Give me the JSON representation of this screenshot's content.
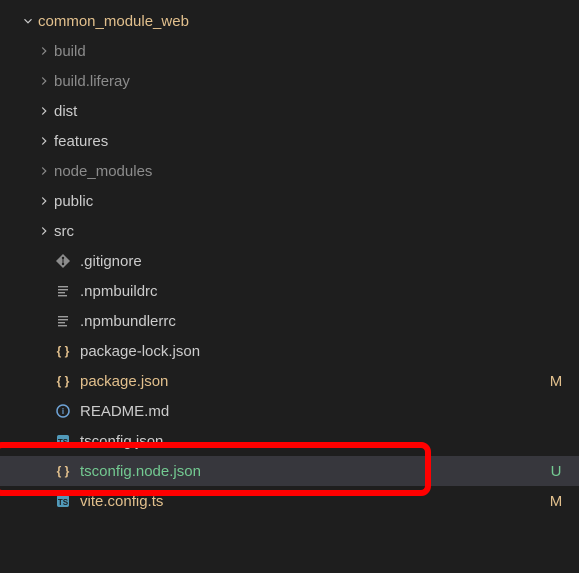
{
  "root": {
    "name": "common_module_web",
    "status_dot": true
  },
  "items": [
    {
      "name": "build",
      "kind": "folder",
      "dim": true
    },
    {
      "name": "build.liferay",
      "kind": "folder",
      "dim": true
    },
    {
      "name": "dist",
      "kind": "folder",
      "dim": false
    },
    {
      "name": "features",
      "kind": "folder",
      "dim": false
    },
    {
      "name": "node_modules",
      "kind": "folder",
      "dim": true
    },
    {
      "name": "public",
      "kind": "folder",
      "dim": false
    },
    {
      "name": "src",
      "kind": "folder",
      "dim": false
    },
    {
      "name": ".gitignore",
      "kind": "git",
      "dim": false
    },
    {
      "name": ".npmbuildrc",
      "kind": "lines",
      "dim": false
    },
    {
      "name": ".npmbundlerrc",
      "kind": "lines",
      "dim": false
    },
    {
      "name": "package-lock.json",
      "kind": "json",
      "dim": false
    },
    {
      "name": "package.json",
      "kind": "json",
      "dim": false,
      "status": "M",
      "statusCls": "c-mod",
      "labelCls": "c-mod"
    },
    {
      "name": "README.md",
      "kind": "md",
      "dim": false
    },
    {
      "name": "tsconfig.json",
      "kind": "ts",
      "dim": false
    },
    {
      "name": "tsconfig.node.json",
      "kind": "json",
      "dim": false,
      "status": "U",
      "statusCls": "c-new",
      "labelCls": "c-new",
      "selected": true,
      "highlighted": true
    },
    {
      "name": "vite.config.ts",
      "kind": "ts",
      "dim": false,
      "status": "M",
      "statusCls": "c-mod",
      "labelCls": "c-mod"
    }
  ]
}
